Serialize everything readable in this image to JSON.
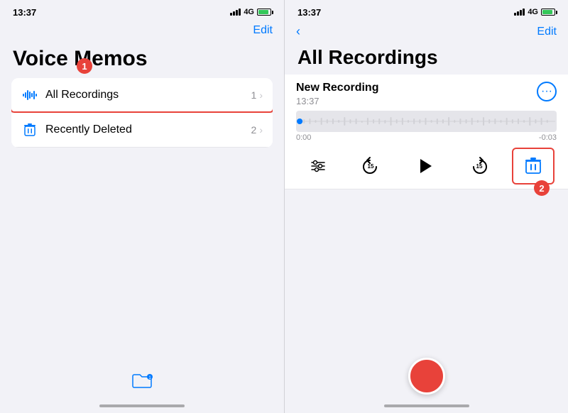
{
  "left_panel": {
    "status_bar": {
      "time": "13:37",
      "signal": "4G",
      "battery_label": "G"
    },
    "nav": {
      "edit_label": "Edit"
    },
    "title": "Voice Memos",
    "list_items": [
      {
        "id": "all-recordings",
        "label": "All Recordings",
        "count": "1",
        "icon": "waveform"
      },
      {
        "id": "recently-deleted",
        "label": "Recently Deleted",
        "count": "2",
        "icon": "trash"
      }
    ],
    "annotation_badge": "1",
    "folder_icon": "🗂"
  },
  "right_panel": {
    "status_bar": {
      "time": "13:37",
      "signal": "4G"
    },
    "nav": {
      "back_label": "",
      "edit_label": "Edit"
    },
    "title": "All Recordings",
    "recording": {
      "name": "New Recording",
      "time": "13:37",
      "duration_start": "0:00",
      "duration_end": "-0:03"
    },
    "annotation_badge": "2",
    "record_btn_label": ""
  }
}
